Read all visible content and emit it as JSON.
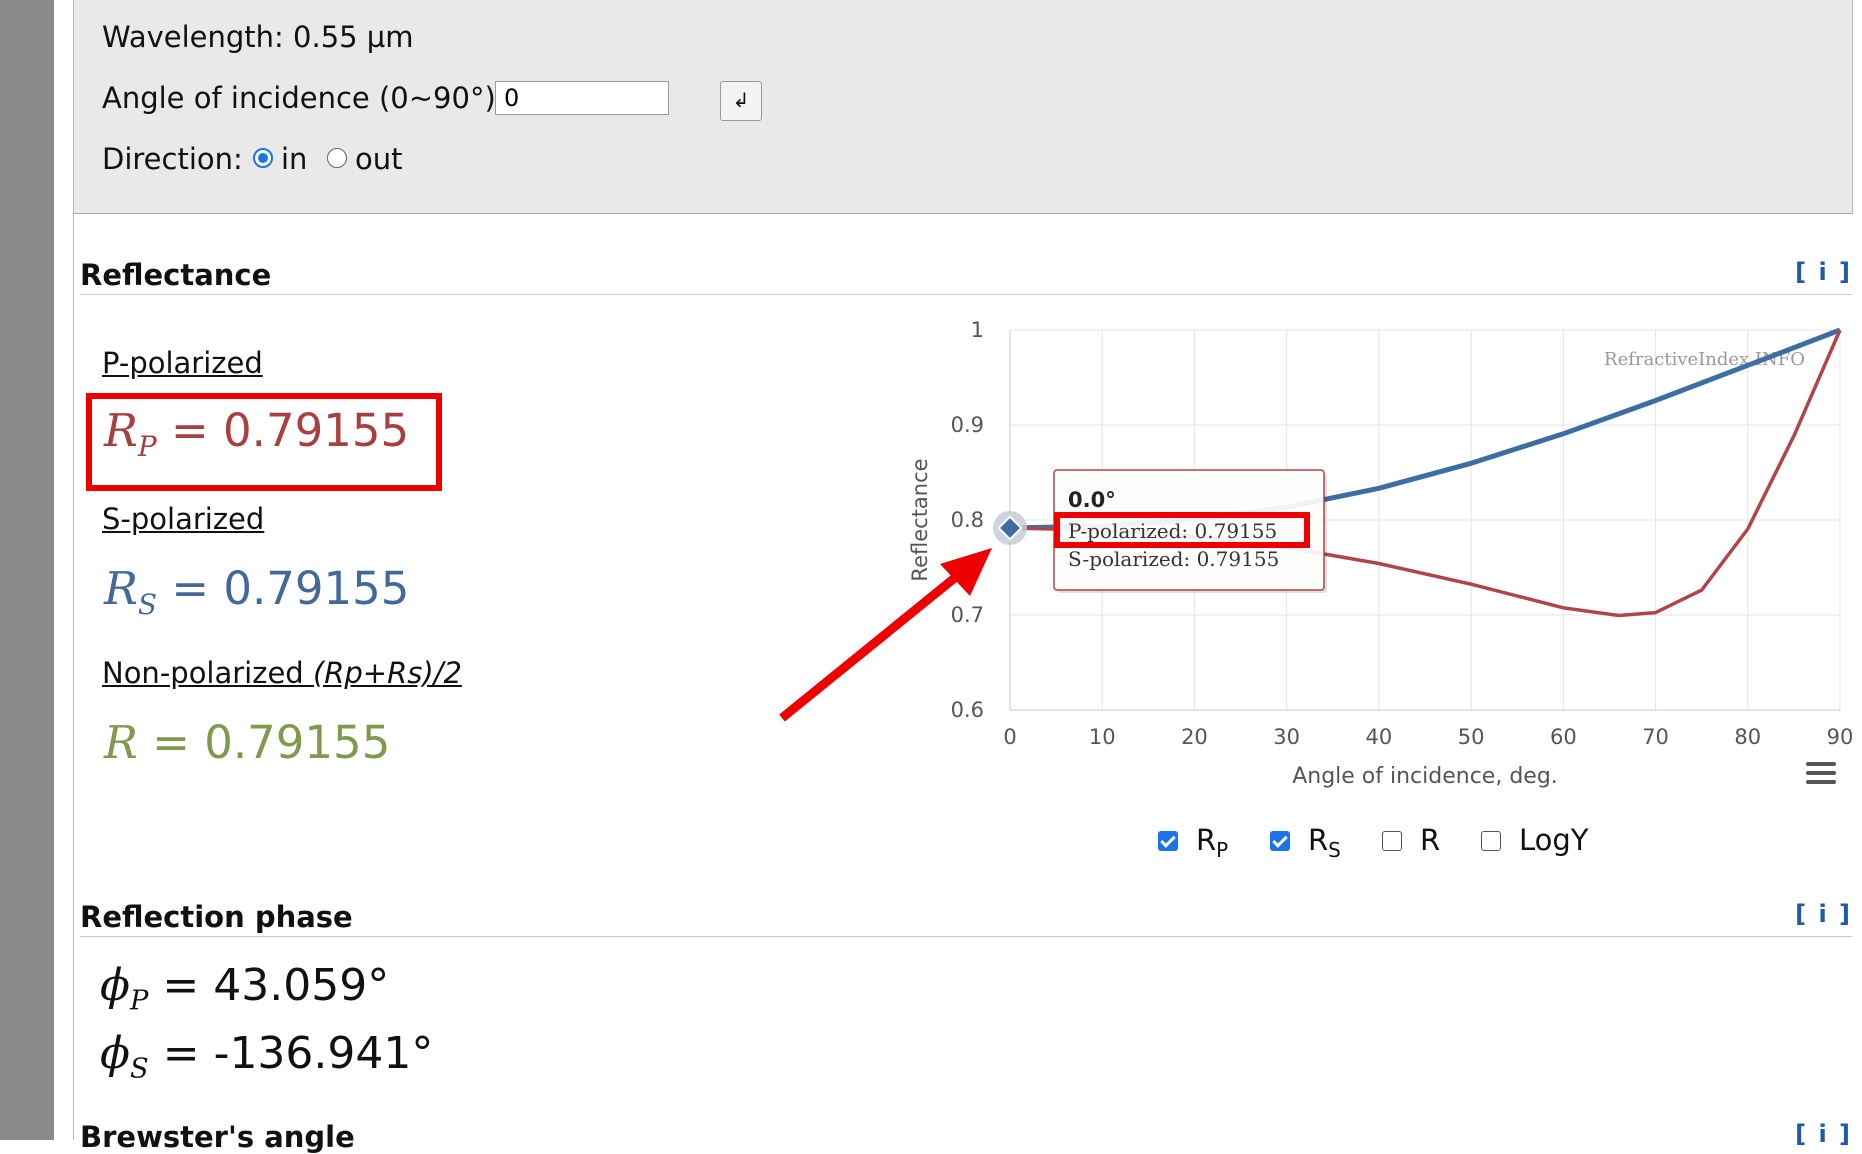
{
  "inputs": {
    "wavelength_label": "Wavelength: 0.55 µm",
    "aoi_label": "Angle of incidence (0~90°):",
    "aoi_value": "0",
    "enter_label": "↲",
    "direction_label": "Direction:",
    "direction_options": [
      "in",
      "out"
    ],
    "direction_selected": "in"
  },
  "reflectance": {
    "title": "Reflectance",
    "info": "[ i ]",
    "p_label": "P-polarized",
    "p_symbol": "R",
    "p_sub": "P",
    "p_value": "0.79155",
    "s_label": "S-polarized",
    "s_symbol": "R",
    "s_sub": "S",
    "s_value": "0.79155",
    "n_label_prefix": "Non-polarized ",
    "n_label_formula": "(Rp+Rs)/2",
    "n_symbol": "R",
    "n_value": "0.79155",
    "eq": "="
  },
  "chart_data": {
    "type": "line",
    "ylabel": "Reflectance",
    "xlabel": "Angle of incidence, deg.",
    "watermark": "RefractiveIndex.INFO",
    "x_ticks": [
      "0",
      "10",
      "20",
      "30",
      "40",
      "50",
      "60",
      "70",
      "80",
      "90"
    ],
    "y_ticks": [
      "0.6",
      "0.7",
      "0.8",
      "0.9",
      "1"
    ],
    "xlim": [
      0,
      90
    ],
    "ylim": [
      0.6,
      1.0
    ],
    "series": [
      {
        "color": "#3c6da3",
        "x": [
          0,
          10,
          20,
          30,
          40,
          50,
          60,
          70,
          80,
          85,
          90
        ],
        "y": [
          0.7916,
          0.7937,
          0.8005,
          0.8135,
          0.8334,
          0.8597,
          0.8907,
          0.9258,
          0.9628,
          0.9814,
          1.0
        ]
      },
      {
        "color": "#b04446",
        "x": [
          0,
          10,
          20,
          30,
          40,
          50,
          60,
          66,
          70,
          75,
          80,
          85,
          90
        ],
        "y": [
          0.7916,
          0.7893,
          0.7827,
          0.7711,
          0.7542,
          0.7324,
          0.7076,
          0.6995,
          0.7025,
          0.7262,
          0.7905,
          0.8885,
          1.0
        ]
      }
    ],
    "tooltip": {
      "title": "0.0°",
      "lines": [
        "P-polarized: 0.79155",
        "S-polarized: 0.79155"
      ]
    },
    "toggles": [
      {
        "label": "R",
        "sub": "P",
        "checked": true
      },
      {
        "label": "R",
        "sub": "S",
        "checked": true
      },
      {
        "label": "R",
        "sub": "",
        "checked": false
      },
      {
        "label": "LogY",
        "sub": "",
        "checked": false
      }
    ]
  },
  "phase": {
    "title": "Reflection phase",
    "info": "[ i ]",
    "p_symbol": "ϕ",
    "p_sub": "P",
    "p_value": "43.059°",
    "s_symbol": "ϕ",
    "s_sub": "S",
    "s_value": "-136.941°"
  },
  "brewster": {
    "title": "Brewster's angle",
    "info": "[ i ]"
  },
  "colors": {
    "p": "#a8403f",
    "s": "#43689a",
    "n": "#7f9a4c",
    "annotation": "#ee0000"
  }
}
